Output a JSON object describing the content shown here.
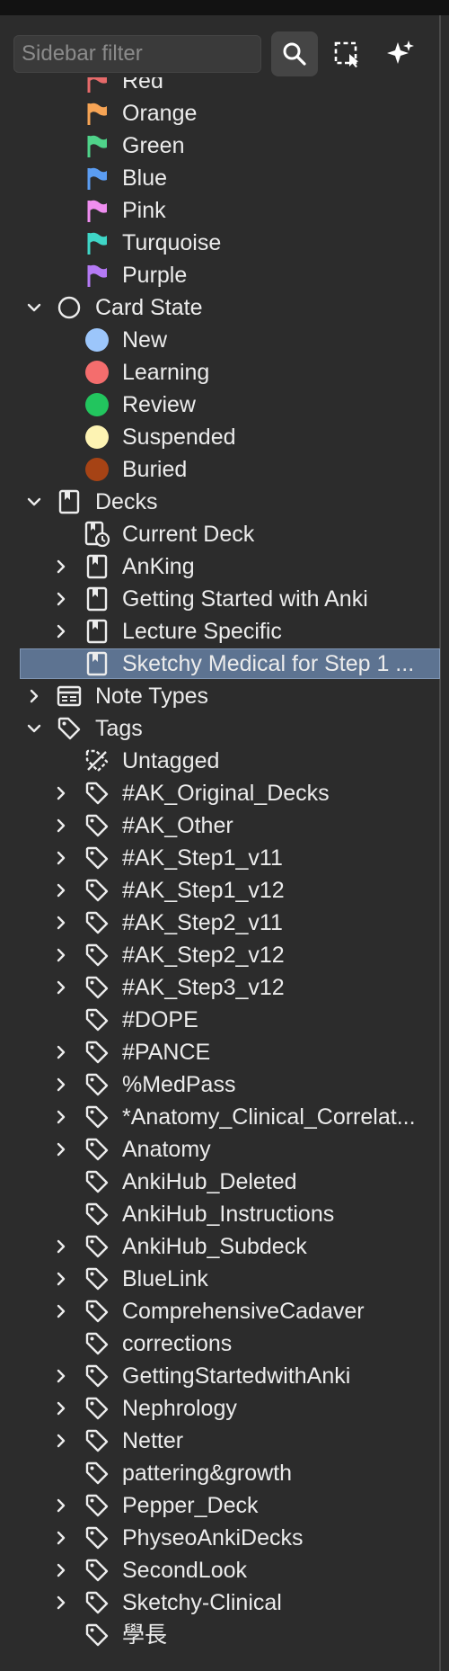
{
  "sidebar": {
    "filter_placeholder": "Sidebar filter",
    "toolbar": {
      "search_icon": "search-icon",
      "select_icon": "rect-select-icon",
      "ai_icon": "sparkles-icon"
    },
    "flags": [
      {
        "label": "Red",
        "color": "#e66a6a"
      },
      {
        "label": "Orange",
        "color": "#f6a455"
      },
      {
        "label": "Green",
        "color": "#4fd38a"
      },
      {
        "label": "Blue",
        "color": "#5b9df2"
      },
      {
        "label": "Pink",
        "color": "#ef8ef0"
      },
      {
        "label": "Turquoise",
        "color": "#3fd6c7"
      },
      {
        "label": "Purple",
        "color": "#b57af5"
      }
    ],
    "card_state": {
      "label": "Card State",
      "items": [
        {
          "label": "New",
          "color": "#9cc6fb"
        },
        {
          "label": "Learning",
          "color": "#f46d6d"
        },
        {
          "label": "Review",
          "color": "#22c55e"
        },
        {
          "label": "Suspended",
          "color": "#fdf3b3"
        },
        {
          "label": "Buried",
          "color": "#a64315"
        }
      ]
    },
    "decks": {
      "label": "Decks",
      "items": [
        {
          "label": "Current Deck",
          "icon": "current-deck-icon",
          "expandable": false
        },
        {
          "label": "AnKing",
          "icon": "deck-icon",
          "expandable": true
        },
        {
          "label": "Getting Started with Anki",
          "icon": "deck-icon",
          "expandable": true
        },
        {
          "label": "Lecture Specific",
          "icon": "deck-icon",
          "expandable": true
        },
        {
          "label": "Sketchy Medical for Step 1 ...",
          "icon": "deck-icon",
          "expandable": false,
          "selected": true
        }
      ]
    },
    "note_types": {
      "label": "Note Types"
    },
    "tags": {
      "label": "Tags",
      "items": [
        {
          "label": "Untagged",
          "icon": "untagged-icon",
          "expandable": false
        },
        {
          "label": "#AK_Original_Decks",
          "expandable": true
        },
        {
          "label": "#AK_Other",
          "expandable": true
        },
        {
          "label": "#AK_Step1_v11",
          "expandable": true
        },
        {
          "label": "#AK_Step1_v12",
          "expandable": true
        },
        {
          "label": "#AK_Step2_v11",
          "expandable": true
        },
        {
          "label": "#AK_Step2_v12",
          "expandable": true
        },
        {
          "label": "#AK_Step3_v12",
          "expandable": true
        },
        {
          "label": "#DOPE",
          "expandable": false
        },
        {
          "label": "#PANCE",
          "expandable": true
        },
        {
          "label": "%MedPass",
          "expandable": true
        },
        {
          "label": "*Anatomy_Clinical_Correlat...",
          "expandable": true
        },
        {
          "label": "Anatomy",
          "expandable": true
        },
        {
          "label": "AnkiHub_Deleted",
          "expandable": false
        },
        {
          "label": "AnkiHub_Instructions",
          "expandable": false
        },
        {
          "label": "AnkiHub_Subdeck",
          "expandable": true
        },
        {
          "label": "BlueLink",
          "expandable": true
        },
        {
          "label": "ComprehensiveCadaver",
          "expandable": true
        },
        {
          "label": "corrections",
          "expandable": false
        },
        {
          "label": "GettingStartedwithAnki",
          "expandable": true
        },
        {
          "label": "Nephrology",
          "expandable": true
        },
        {
          "label": "Netter",
          "expandable": true
        },
        {
          "label": "pattering&growth",
          "expandable": false
        },
        {
          "label": "Pepper_Deck",
          "expandable": true
        },
        {
          "label": "PhyseoAnkiDecks",
          "expandable": true
        },
        {
          "label": "SecondLook",
          "expandable": true
        },
        {
          "label": "Sketchy-Clinical",
          "expandable": true
        },
        {
          "label": "學長",
          "expandable": false
        }
      ]
    }
  }
}
